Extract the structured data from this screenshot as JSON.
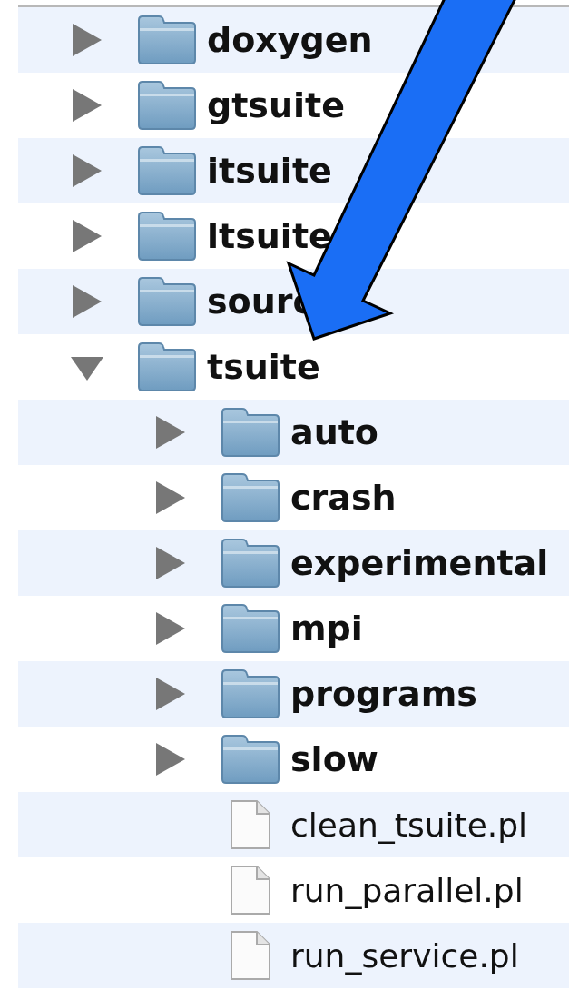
{
  "file_list": {
    "items": [
      {
        "kind": "folder",
        "name": "doxygen",
        "expanded": false
      },
      {
        "kind": "folder",
        "name": "gtsuite",
        "expanded": false
      },
      {
        "kind": "folder",
        "name": "itsuite",
        "expanded": false
      },
      {
        "kind": "folder",
        "name": "ltsuite",
        "expanded": false
      },
      {
        "kind": "folder",
        "name": "sourc",
        "expanded": false
      },
      {
        "kind": "folder",
        "name": "tsuite",
        "expanded": true,
        "children": [
          {
            "kind": "folder",
            "name": "auto",
            "expanded": false
          },
          {
            "kind": "folder",
            "name": "crash",
            "expanded": false
          },
          {
            "kind": "folder",
            "name": "experimental",
            "expanded": false
          },
          {
            "kind": "folder",
            "name": "mpi",
            "expanded": false
          },
          {
            "kind": "folder",
            "name": "programs",
            "expanded": false
          },
          {
            "kind": "folder",
            "name": "slow",
            "expanded": false
          },
          {
            "kind": "file",
            "name": "clean_tsuite.pl"
          },
          {
            "kind": "file",
            "name": "run_parallel.pl"
          },
          {
            "kind": "file",
            "name": "run_service.pl"
          }
        ]
      }
    ]
  }
}
